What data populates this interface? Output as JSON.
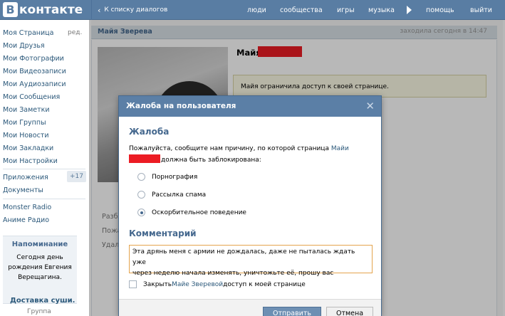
{
  "header": {
    "logo_letter": "В",
    "logo_text": "контакте",
    "back_link": "К списку диалогов",
    "nav": [
      "люди",
      "сообщества",
      "игры",
      "музыка",
      "помощь",
      "выйти"
    ]
  },
  "sidebar": {
    "items": [
      "Моя Страница",
      "Мои Друзья",
      "Мои Фотографии",
      "Мои Видеозаписи",
      "Мои Аудиозаписи",
      "Мои Сообщения",
      "Мои Заметки",
      "Мои Группы",
      "Мои Новости",
      "Мои Закладки",
      "Мои Настройки"
    ],
    "edit_label": "ред.",
    "apps": "Приложения",
    "apps_count": "+17",
    "docs": "Документы",
    "extra": [
      "Monster Radio",
      "Аниме Радио"
    ],
    "reminder_title": "Напоминание",
    "reminder_lines": [
      "Сегодня день",
      "рождения Евгения",
      "Верещагина."
    ],
    "ad_title": "Доставка суши.",
    "ad_sub": "Группа"
  },
  "profile": {
    "bar_name": "Майя Зверева",
    "last_seen": "заходила сегодня в 14:47",
    "name": "Майя",
    "restricted_text": "Майя ограничила доступ к своей странице.",
    "info_labels": [
      "Разбл",
      "Пожа",
      "Удал"
    ]
  },
  "dialog": {
    "title": "Жалоба на пользователя",
    "section_complaint": "Жалоба",
    "desc_before": "Пожалуйста, сообщите нам причину, по которой страница ",
    "desc_link": "Майи",
    "desc_after": "должна быть заблокирована:",
    "reasons": [
      "Порнография",
      "Рассылка спама",
      "Оскорбительное поведение"
    ],
    "selected_reason": "Оскорбительное поведение",
    "section_comment": "Комментарий",
    "comment_lines": [
      "Эта дрянь меня с армии не дождалась, даже не пыталась ждать уже",
      "через неделю начала изменять, уничтожьте её, прошу вас"
    ],
    "close_prefix": "Закрыть ",
    "close_link": "Майе Зверевой",
    "close_suffix": " доступ к моей странице",
    "send_button": "Отправить",
    "cancel_button": "Отмена"
  },
  "colors": {
    "header": "#597da3",
    "link": "#2b587a",
    "redaction": "#ec1c24",
    "comment_border": "#e4a44d"
  }
}
